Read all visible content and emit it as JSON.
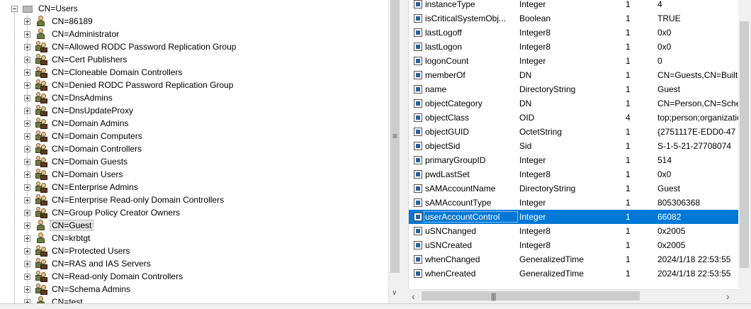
{
  "tree": {
    "root_label": "CN=Users",
    "items": [
      {
        "label": "CN=86189",
        "icon": "user-icon"
      },
      {
        "label": "CN=Administrator",
        "icon": "user-icon"
      },
      {
        "label": "CN=Allowed RODC Password Replication Group",
        "icon": "group-icon"
      },
      {
        "label": "CN=Cert Publishers",
        "icon": "group-icon"
      },
      {
        "label": "CN=Cloneable Domain Controllers",
        "icon": "group-icon"
      },
      {
        "label": "CN=Denied RODC Password Replication Group",
        "icon": "group-icon"
      },
      {
        "label": "CN=DnsAdmins",
        "icon": "group-icon"
      },
      {
        "label": "CN=DnsUpdateProxy",
        "icon": "group-icon"
      },
      {
        "label": "CN=Domain Admins",
        "icon": "group-icon"
      },
      {
        "label": "CN=Domain Computers",
        "icon": "group-icon"
      },
      {
        "label": "CN=Domain Controllers",
        "icon": "group-icon"
      },
      {
        "label": "CN=Domain Guests",
        "icon": "group-icon"
      },
      {
        "label": "CN=Domain Users",
        "icon": "group-icon"
      },
      {
        "label": "CN=Enterprise Admins",
        "icon": "group-icon"
      },
      {
        "label": "CN=Enterprise Read-only Domain Controllers",
        "icon": "group-icon"
      },
      {
        "label": "CN=Group Policy Creator Owners",
        "icon": "group-icon"
      },
      {
        "label": "CN=Guest",
        "icon": "user-icon",
        "selected": true
      },
      {
        "label": "CN=krbtgt",
        "icon": "user-icon"
      },
      {
        "label": "CN=Protected Users",
        "icon": "group-icon"
      },
      {
        "label": "CN=RAS and IAS Servers",
        "icon": "group-icon"
      },
      {
        "label": "CN=Read-only Domain Controllers",
        "icon": "group-icon"
      },
      {
        "label": "CN=Schema Admins",
        "icon": "group-icon"
      },
      {
        "label": "CN=test",
        "icon": "user-icon"
      }
    ]
  },
  "properties": [
    {
      "name": "instanceType",
      "syntax": "Integer",
      "count": "1",
      "value": "4"
    },
    {
      "name": "isCriticalSystemObj...",
      "syntax": "Boolean",
      "count": "1",
      "value": "TRUE"
    },
    {
      "name": "lastLogoff",
      "syntax": "Integer8",
      "count": "1",
      "value": "0x0"
    },
    {
      "name": "lastLogon",
      "syntax": "Integer8",
      "count": "1",
      "value": "0x0"
    },
    {
      "name": "logonCount",
      "syntax": "Integer",
      "count": "1",
      "value": "0"
    },
    {
      "name": "memberOf",
      "syntax": "DN",
      "count": "1",
      "value": "CN=Guests,CN=Builtin"
    },
    {
      "name": "name",
      "syntax": "DirectoryString",
      "count": "1",
      "value": "Guest"
    },
    {
      "name": "objectCategory",
      "syntax": "DN",
      "count": "1",
      "value": "CN=Person,CN=Schema"
    },
    {
      "name": "objectClass",
      "syntax": "OID",
      "count": "4",
      "value": "top;person;organizationalPerson"
    },
    {
      "name": "objectGUID",
      "syntax": "OctetString",
      "count": "1",
      "value": "{2751117E-EDD0-47"
    },
    {
      "name": "objectSid",
      "syntax": "Sid",
      "count": "1",
      "value": "S-1-5-21-27708074"
    },
    {
      "name": "primaryGroupID",
      "syntax": "Integer",
      "count": "1",
      "value": "514"
    },
    {
      "name": "pwdLastSet",
      "syntax": "Integer8",
      "count": "1",
      "value": "0x0"
    },
    {
      "name": "sAMAccountName",
      "syntax": "DirectoryString",
      "count": "1",
      "value": "Guest"
    },
    {
      "name": "sAMAccountType",
      "syntax": "Integer",
      "count": "1",
      "value": "805306368"
    },
    {
      "name": "userAccountControl",
      "syntax": "Integer",
      "count": "1",
      "value": "66082",
      "selected": true
    },
    {
      "name": "uSNChanged",
      "syntax": "Integer8",
      "count": "1",
      "value": "0x2005"
    },
    {
      "name": "uSNCreated",
      "syntax": "Integer8",
      "count": "1",
      "value": "0x2005"
    },
    {
      "name": "whenChanged",
      "syntax": "GeneralizedTime",
      "count": "1",
      "value": "2024/1/18 22:53:55"
    },
    {
      "name": "whenCreated",
      "syntax": "GeneralizedTime",
      "count": "1",
      "value": "2024/1/18 22:53:55"
    }
  ],
  "colors": {
    "selection": "#0078d7"
  }
}
